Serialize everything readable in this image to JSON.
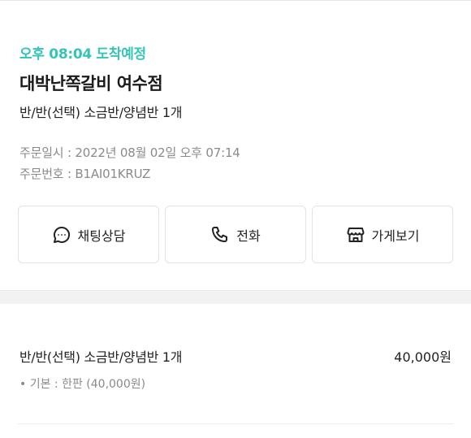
{
  "order": {
    "eta": "오후 08:04 도착예정",
    "store_name": "대박난쪽갈비 여수점",
    "menu_summary": "반/반(선택) 소금반/양념반 1개",
    "order_date": "주문일시 : 2022년 08월 02일 오후 07:14",
    "order_number": "주문번호 : B1AI01KRUZ",
    "accent_color": "#35c5b8"
  },
  "actions": {
    "chat_label": "채팅상담",
    "call_label": "전화",
    "store_label": "가게보기"
  },
  "items": [
    {
      "name": "반/반(선택) 소금반/양념반 1개",
      "price": "40,000원",
      "option": "• 기본 : 한판 (40,000원)"
    }
  ]
}
